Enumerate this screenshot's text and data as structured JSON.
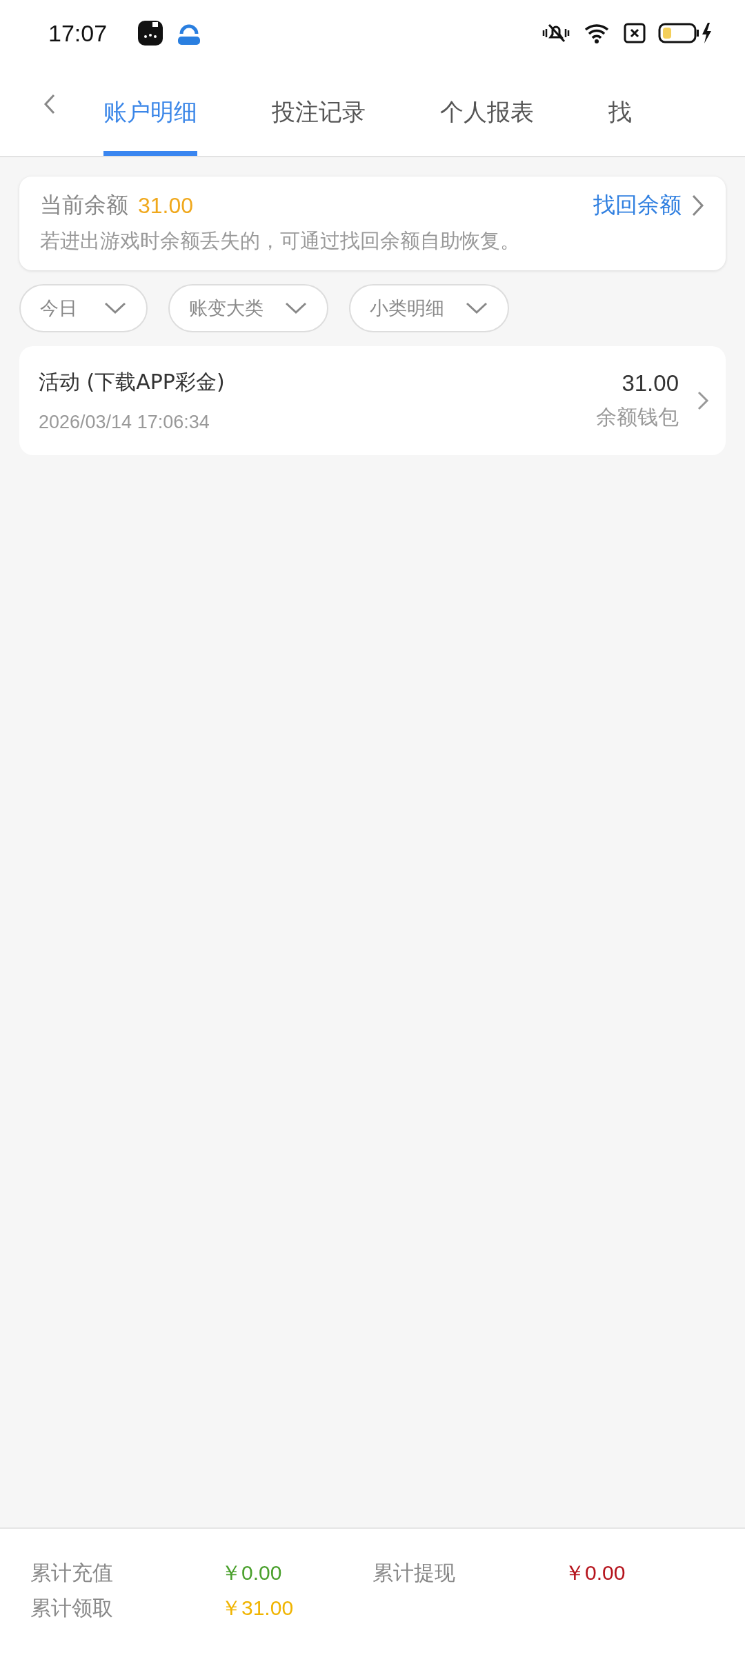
{
  "status_bar": {
    "time": "17:07"
  },
  "tabs": [
    {
      "label": "账户明细",
      "selected": true
    },
    {
      "label": "投注记录",
      "selected": false
    },
    {
      "label": "个人报表",
      "selected": false
    },
    {
      "label": "找",
      "selected": false
    }
  ],
  "balance_card": {
    "label": "当前余额",
    "amount": "31.00",
    "link": "找回余额",
    "note": "若进出游戏时余额丢失的，可通过找回余额自助恢复。"
  },
  "filters": [
    {
      "label": "今日"
    },
    {
      "label": "账变大类"
    },
    {
      "label": "小类明细"
    }
  ],
  "records": [
    {
      "title": "活动 (下载APP彩金)",
      "time": "2026/03/14 17:06:34",
      "amount": "31.00",
      "wallet": "余额钱包"
    }
  ],
  "summary": [
    {
      "label": "累计充值",
      "value": "￥0.00",
      "color": "#4aa02c"
    },
    {
      "label": "累计提现",
      "value": "￥0.00",
      "color": "#b5121b"
    },
    {
      "label": "累计领取",
      "value": "￥31.00",
      "color": "#f0b400"
    }
  ]
}
